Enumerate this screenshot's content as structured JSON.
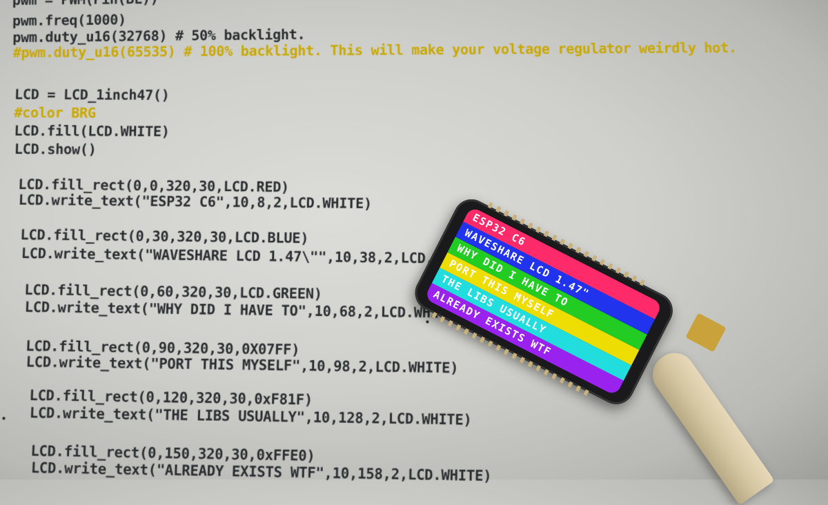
{
  "code_lines": [
    {
      "text": "pwm = PWM(Pin(BL))"
    },
    {
      "text": "pwm.freq(1000)"
    },
    {
      "text": "pwm.duty_u16(32768) # 50% backlight."
    },
    {
      "text": "#pwm.duty_u16(65535) # 100% backlight. This will make your voltage regulator weirdly hot."
    },
    {
      "text": "LCD = LCD_1inch47()"
    },
    {
      "text": "#color BRG"
    },
    {
      "text": "LCD.fill(LCD.WHITE)"
    },
    {
      "text": "LCD.show()"
    },
    {
      "text": "LCD.fill_rect(0,0,320,30,LCD.RED)"
    },
    {
      "text": "LCD.write_text(\"ESP32 C6\",10,8,2,LCD.WHITE)"
    },
    {
      "text": "LCD.fill_rect(0,30,320,30,LCD.BLUE)"
    },
    {
      "text": "LCD.write_text(\"WAVESHARE LCD 1.47\\\"\",10,38,2,LCD."
    },
    {
      "text": "LCD.fill_rect(0,60,320,30,LCD.GREEN)"
    },
    {
      "text": "LCD.write_text(\"WHY DID I HAVE TO\",10,68,2,LCD.WHITE)"
    },
    {
      "text": "LCD.fill_rect(0,90,320,30,0X07FF)"
    },
    {
      "text": "LCD.write_text(\"PORT THIS MYSELF\",10,98,2,LCD.WHITE)"
    },
    {
      "text": "LCD.fill_rect(0,120,320,30,0xF81F)"
    },
    {
      "text": "LCD.write_text(\"THE LIBS USUALLY\",10,128,2,LCD.WHITE)"
    },
    {
      "text": "LCD.fill_rect(0,150,320,30,0xFFE0)"
    },
    {
      "text": "LCD.write_text(\"ALREADY EXISTS WTF\",10,158,2,LCD.WHITE)"
    }
  ],
  "lcd_bands": [
    {
      "text": "ESP32 C6",
      "color": "#ff2a6a"
    },
    {
      "text": "WAVESHARE LCD 1.47\"",
      "color": "#2233ee"
    },
    {
      "text": "WHY DID I HAVE TO",
      "color": "#22cc22"
    },
    {
      "text": "PORT THIS MYSELF",
      "color": "#eedd00"
    },
    {
      "text": "THE LIBS USUALLY",
      "color": "#22dddd"
    },
    {
      "text": "ALREADY EXISTS WTF",
      "color": "#9922ee"
    }
  ],
  "colors": {
    "code_text": "#2a2c30",
    "comment": "#c9a800"
  }
}
